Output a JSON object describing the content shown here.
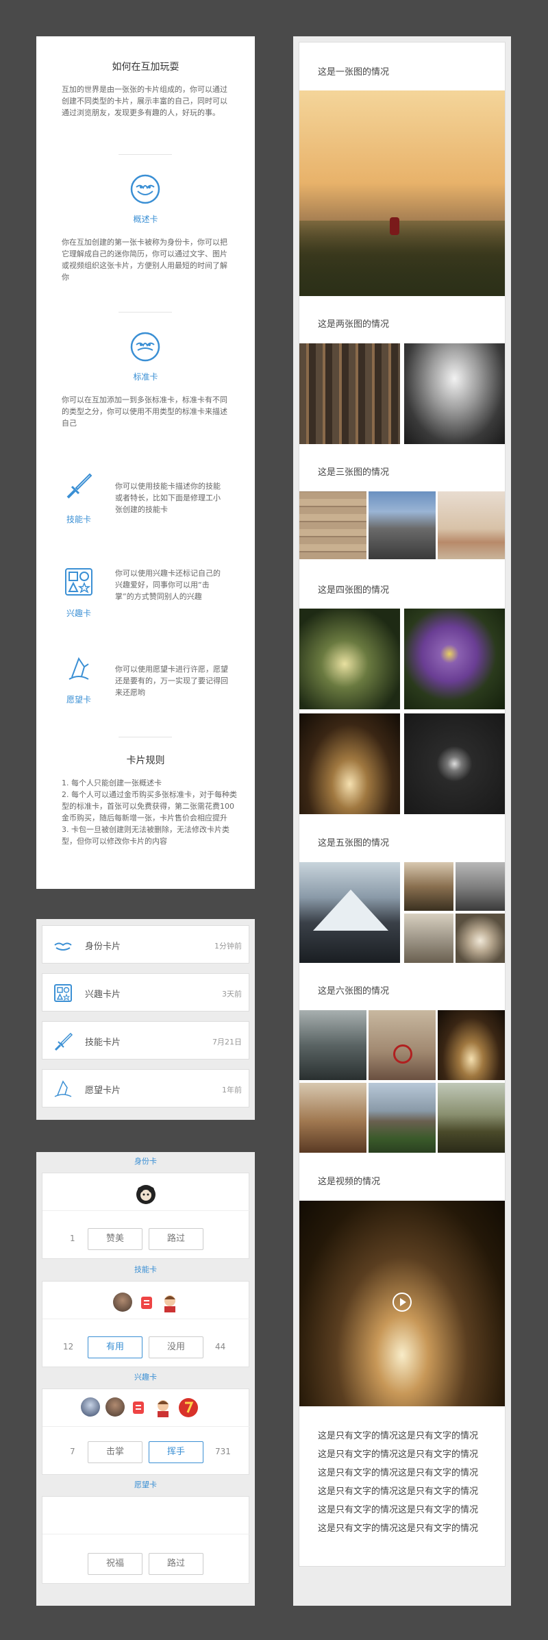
{
  "intro": {
    "title": "如何在互加玩耍",
    "para": "互加的世界是由一张张的卡片组成的，你可以通过创建不同类型的卡片，展示丰富的自己，同时可以通过浏览朋友，发现更多有趣的人，好玩的事。",
    "summary_card": {
      "name": "概述卡",
      "desc": "你在互加创建的第一张卡被称为身份卡，你可以把它理解成自己的迷你简历，你可以通过文字、图片或视频组织这张卡片，方便别人用最短的时间了解你"
    },
    "standard_card": {
      "name": "标准卡",
      "desc": "你可以在互加添加一到多张标准卡，标准卡有不同的类型之分，你可以使用不用类型的标准卡来描述自己"
    },
    "skill_card": {
      "name": "技能卡",
      "desc": "你可以使用技能卡描述你的技能或者特长，比如下面是修理工小张创建的技能卡"
    },
    "interest_card": {
      "name": "兴趣卡",
      "desc": "你可以使用兴趣卡还标记自己的兴趣爱好，同事你可以用“击掌”的方式赞同别人的兴趣"
    },
    "wish_card": {
      "name": "愿望卡",
      "desc": "你可以使用愿望卡进行许愿，愿望还是要有的，万一实现了要记得回来还愿哟"
    },
    "rules_title": "卡片规则",
    "rules": [
      "1. 每个人只能创建一张概述卡",
      "2. 每个人可以通过金币购买多张标准卡，对于每种类型的标准卡，首张可以免费获得，第二张需花费100金币购买，随后每新增一张，卡片售价会相应提升",
      "3. 卡包一旦被创建则无法被删除，无法修改卡片类型，但你可以修改你卡片的内容"
    ]
  },
  "cardlist": [
    {
      "label": "身份卡片",
      "time": "1分钟前",
      "icon": "identity-icon"
    },
    {
      "label": "兴趣卡片",
      "time": "3天前",
      "icon": "interest-icon"
    },
    {
      "label": "技能卡片",
      "time": "7月21日",
      "icon": "skill-icon"
    },
    {
      "label": "愿望卡片",
      "time": "1年前",
      "icon": "wish-icon"
    }
  ],
  "actions": {
    "identity": {
      "header": "身份卡",
      "left_num": "1",
      "btn1": "赞美",
      "btn2": "路过"
    },
    "skill": {
      "header": "技能卡",
      "left_num": "12",
      "btn1": "有用",
      "btn2": "没用",
      "right_num": "44"
    },
    "interest": {
      "header": "兴趣卡",
      "left_num": "7",
      "btn1": "击掌",
      "btn2": "挥手",
      "right_num": "731"
    },
    "wish": {
      "header": "愿望卡",
      "btn1": "祝福",
      "btn2": "路过"
    }
  },
  "feed": {
    "one": "这是一张图的情况",
    "two": "这是两张图的情况",
    "three": "这是三张图的情况",
    "four": "这是四张图的情况",
    "five": "这是五张图的情况",
    "six": "这是六张图的情况",
    "video": "这是视频的情况",
    "text_lines": [
      "这是只有文字的情况这是只有文字的情况",
      "这是只有文字的情况这是只有文字的情况",
      "这是只有文字的情况这是只有文字的情况",
      "这是只有文字的情况这是只有文字的情况",
      "这是只有文字的情况这是只有文字的情况",
      "这是只有文字的情况这是只有文字的情况"
    ]
  }
}
